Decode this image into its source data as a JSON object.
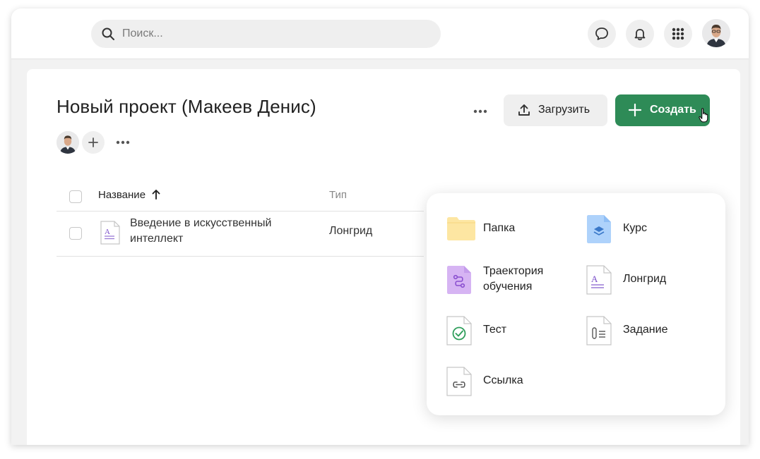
{
  "search": {
    "placeholder": "Поиск..."
  },
  "topbar": {
    "icons": [
      "chat-icon",
      "bell-icon",
      "apps-grid-icon"
    ]
  },
  "project": {
    "title": "Новый проект (Макеев Денис)",
    "actions": {
      "upload_label": "Загрузить",
      "create_label": "Создать"
    }
  },
  "table": {
    "columns": {
      "name": "Название",
      "type": "Тип"
    },
    "sort": "name-ascending",
    "rows": [
      {
        "name": "Введение в искусственный интеллект",
        "type": "Лонгрид"
      }
    ]
  },
  "create_menu": {
    "items": [
      {
        "label": "Папка",
        "icon": "folder-icon"
      },
      {
        "label": "Курс",
        "icon": "course-icon"
      },
      {
        "label": "Траектория\nобучения",
        "icon": "learning-path-icon"
      },
      {
        "label": "Лонгрид",
        "icon": "longread-icon"
      },
      {
        "label": "Тест",
        "icon": "test-icon"
      },
      {
        "label": "Задание",
        "icon": "assignment-icon"
      },
      {
        "label": "Ссылка",
        "icon": "link-icon"
      }
    ]
  },
  "colors": {
    "primary": "#2e8b57",
    "folder": "#fde6a2",
    "course": "#aed2fb",
    "path": "#d6b4f3",
    "test_check": "#2e9e5b"
  }
}
